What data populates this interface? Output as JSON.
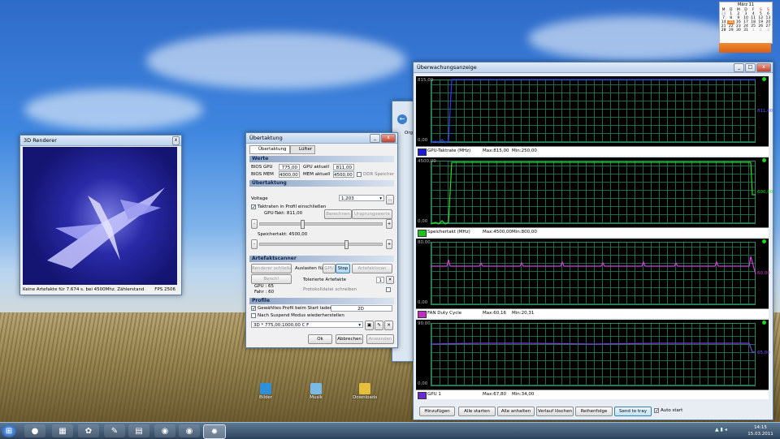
{
  "renderer": {
    "title": "3D Renderer",
    "status": "Keine Artefakte für 7.674 s. bei 4500Mhz. Zählerstand ist 0",
    "fps": "FPS 2506"
  },
  "oc": {
    "title": "Übertaktung",
    "tabs": [
      "Übertaktung",
      "Lüfter"
    ],
    "werte": {
      "header": "Werte",
      "bios_gpu_label": "BIOS GPU",
      "bios_gpu": "775,00",
      "gpu_aktuell_label": "GPU aktuell",
      "gpu_aktuell": "811,00",
      "bios_mem_label": "BIOS MEM",
      "bios_mem": "4000,00",
      "mem_aktuell_label": "MEM aktuell",
      "mem_aktuell": "4500,00",
      "ddr_label": "DDR Speicher"
    },
    "uebertaktung": {
      "header": "Übertaktung",
      "voltage_label": "Voltage",
      "voltage_value": "1,203",
      "taktraten_label": "Taktraten in Profil einschließen",
      "gpu_takt": "GPU-Takt: 811,00",
      "berechnen": "Berechnen",
      "ursprung": "Ursprungswerte",
      "speicher_takt": "Speichertakt: 4500,00"
    },
    "artefakt": {
      "header": "Artefaktscanner",
      "renderer_btn": "Renderer schließen",
      "auslasten": "Auslasten für",
      "gpu_btn": "GPU",
      "stop_btn": "Stop",
      "scan_btn": "Artefaktscan",
      "bench_btn": "Bench!",
      "tolerierte": "Tolerierte Artefakte",
      "tolerierte_value": "1",
      "gpu_val": "GPU : 65",
      "fahr_val": "Fahr : 60",
      "protokoll": "Protokolldatei schreiben"
    },
    "profile": {
      "header": "Profile",
      "gewaehltes": "Gewähltes Profil beim Start laden",
      "gewaehltes_value": "2D",
      "nach_suspend": "Nach Suspend Modus wiederherstellen",
      "profile_value": "3D * 775,00:1000,00 C F"
    },
    "buttons": {
      "ok": "Ok",
      "abbrechen": "Abbrechen",
      "anwenden": "Anwenden"
    }
  },
  "monitor": {
    "title": "Überwachungsanzeige",
    "graphs": [
      {
        "top": "815,00",
        "bottom": "0,00",
        "right": "811,00",
        "legend": "GPU-Taktrate (MHz)",
        "max": "Max:815,00",
        "min": "Min:250,00",
        "color": "#1a1ad8"
      },
      {
        "top": "4500,00",
        "bottom": "0,00",
        "right": "600,00",
        "legend": "Speichertakt (MHz)",
        "max": "Max:4500,00",
        "min": "Min:800,00",
        "color": "#1ec21e"
      },
      {
        "top": "80,00",
        "bottom": "0,00",
        "right": "60,00",
        "legend": "FAN Duty Cycle",
        "max": "Max:60,16",
        "min": "Min:20,31",
        "color": "#c22ec2"
      },
      {
        "top": "90,00",
        "bottom": "0,00",
        "right": "65,00",
        "legend": "GPU 1",
        "max": "Max:67,80",
        "min": "Min:34,00",
        "color": "#6a28d8"
      }
    ],
    "buttons": [
      "Hinzufügen",
      "Alle starten",
      "Alle anhalten",
      "Verlauf löschen",
      "Reihenfolge",
      "Send to tray"
    ],
    "autostart": "Auto start"
  },
  "desktop": {
    "icons": [
      "Bilder",
      "Musik",
      "Downloads"
    ],
    "partial_window_text": "Orga"
  },
  "calendar": {
    "month": "März 11",
    "days_header": [
      "M",
      "D",
      "M",
      "D",
      "F",
      "S",
      "S"
    ],
    "rows": [
      [
        "28",
        "1",
        "2",
        "3",
        "4",
        "5",
        "6"
      ],
      [
        "7",
        "8",
        "9",
        "10",
        "11",
        "12",
        "13"
      ],
      [
        "14",
        "15",
        "16",
        "17",
        "18",
        "19",
        "20"
      ],
      [
        "21",
        "22",
        "23",
        "24",
        "25",
        "26",
        "27"
      ],
      [
        "28",
        "29",
        "30",
        "31",
        "1",
        "2",
        "3"
      ]
    ],
    "today": "15"
  },
  "clock": {
    "time": "14:15",
    "date": "15.03.2011"
  }
}
